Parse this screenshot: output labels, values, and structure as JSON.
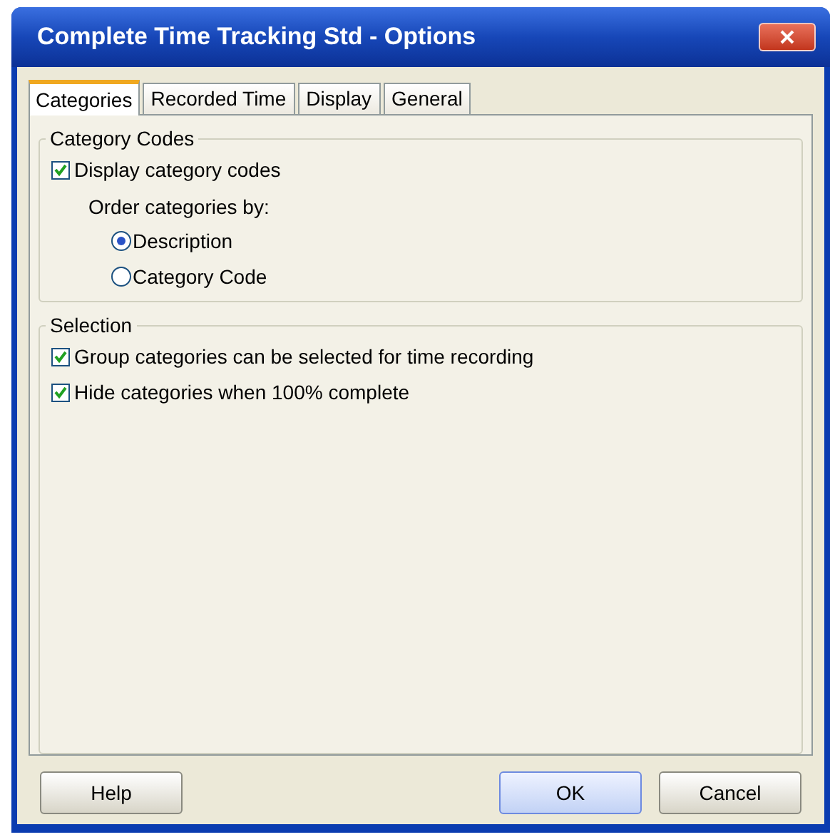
{
  "window": {
    "title": "Complete Time Tracking Std - Options"
  },
  "tabs": [
    {
      "label": "Categories",
      "selected": true
    },
    {
      "label": "Recorded Time",
      "selected": false
    },
    {
      "label": "Display",
      "selected": false
    },
    {
      "label": "General",
      "selected": false
    }
  ],
  "groups": [
    {
      "title": "Category Codes",
      "items": [
        {
          "kind": "checkbox",
          "label": "Display category codes",
          "checked": true
        },
        {
          "kind": "label",
          "label": "Order categories by:"
        },
        {
          "kind": "radio",
          "label": "Description",
          "selected": true
        },
        {
          "kind": "radio",
          "label": "Category Code",
          "selected": false
        }
      ]
    },
    {
      "title": "Selection",
      "items": [
        {
          "kind": "checkbox",
          "label": "Group categories can be selected for time recording",
          "checked": true
        },
        {
          "kind": "checkbox",
          "label": "Hide categories when 100% complete",
          "checked": true
        }
      ]
    }
  ],
  "buttons": [
    {
      "label": "Help",
      "default": false
    },
    {
      "label": "OK",
      "default": true
    },
    {
      "label": "Cancel",
      "default": false
    }
  ]
}
